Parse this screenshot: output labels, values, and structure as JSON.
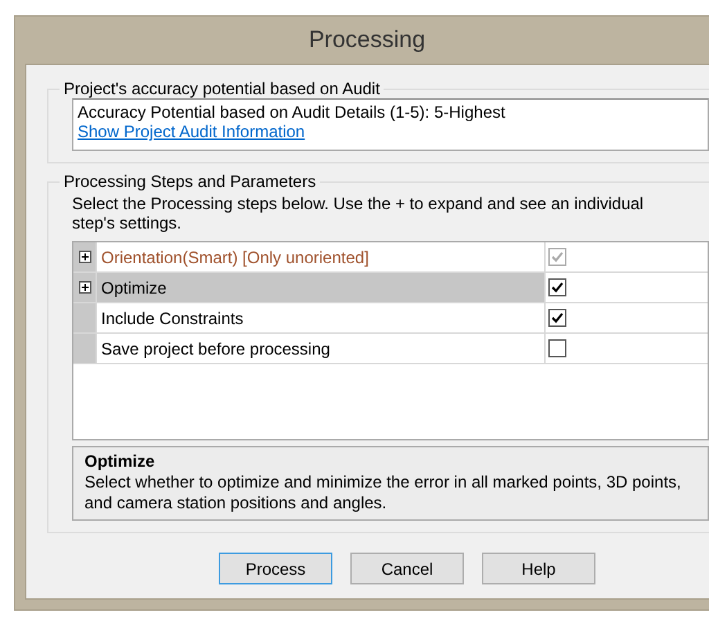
{
  "window": {
    "title": "Processing"
  },
  "audit_group": {
    "title": "Project's accuracy potential based on Audit",
    "text": "Accuracy Potential based on Audit Details (1-5): 5-Highest",
    "link": "Show Project Audit Information"
  },
  "steps_group": {
    "title": "Processing Steps and Parameters",
    "instructions": "Select the Processing steps below. Use the + to expand and see an individual step's settings.",
    "rows": [
      {
        "kind": "expandable",
        "expanded": false,
        "label": "Orientation(Smart) [Only unoriented]",
        "checked": true,
        "disabled": true,
        "selected": false
      },
      {
        "kind": "expandable",
        "expanded": false,
        "label": "Optimize",
        "checked": true,
        "disabled": false,
        "selected": true
      },
      {
        "kind": "plain",
        "label": "Include Constraints",
        "checked": true,
        "disabled": false,
        "selected": false
      },
      {
        "kind": "plain",
        "label": "Save project before processing",
        "checked": false,
        "disabled": false,
        "selected": false
      }
    ],
    "description": {
      "title": "Optimize",
      "text": "Select whether to optimize and minimize the error in all marked points, 3D points, and camera station positions and angles."
    }
  },
  "buttons": [
    {
      "label": "Process",
      "default": true
    },
    {
      "label": "Cancel",
      "default": false
    },
    {
      "label": "Help",
      "default": false
    }
  ]
}
